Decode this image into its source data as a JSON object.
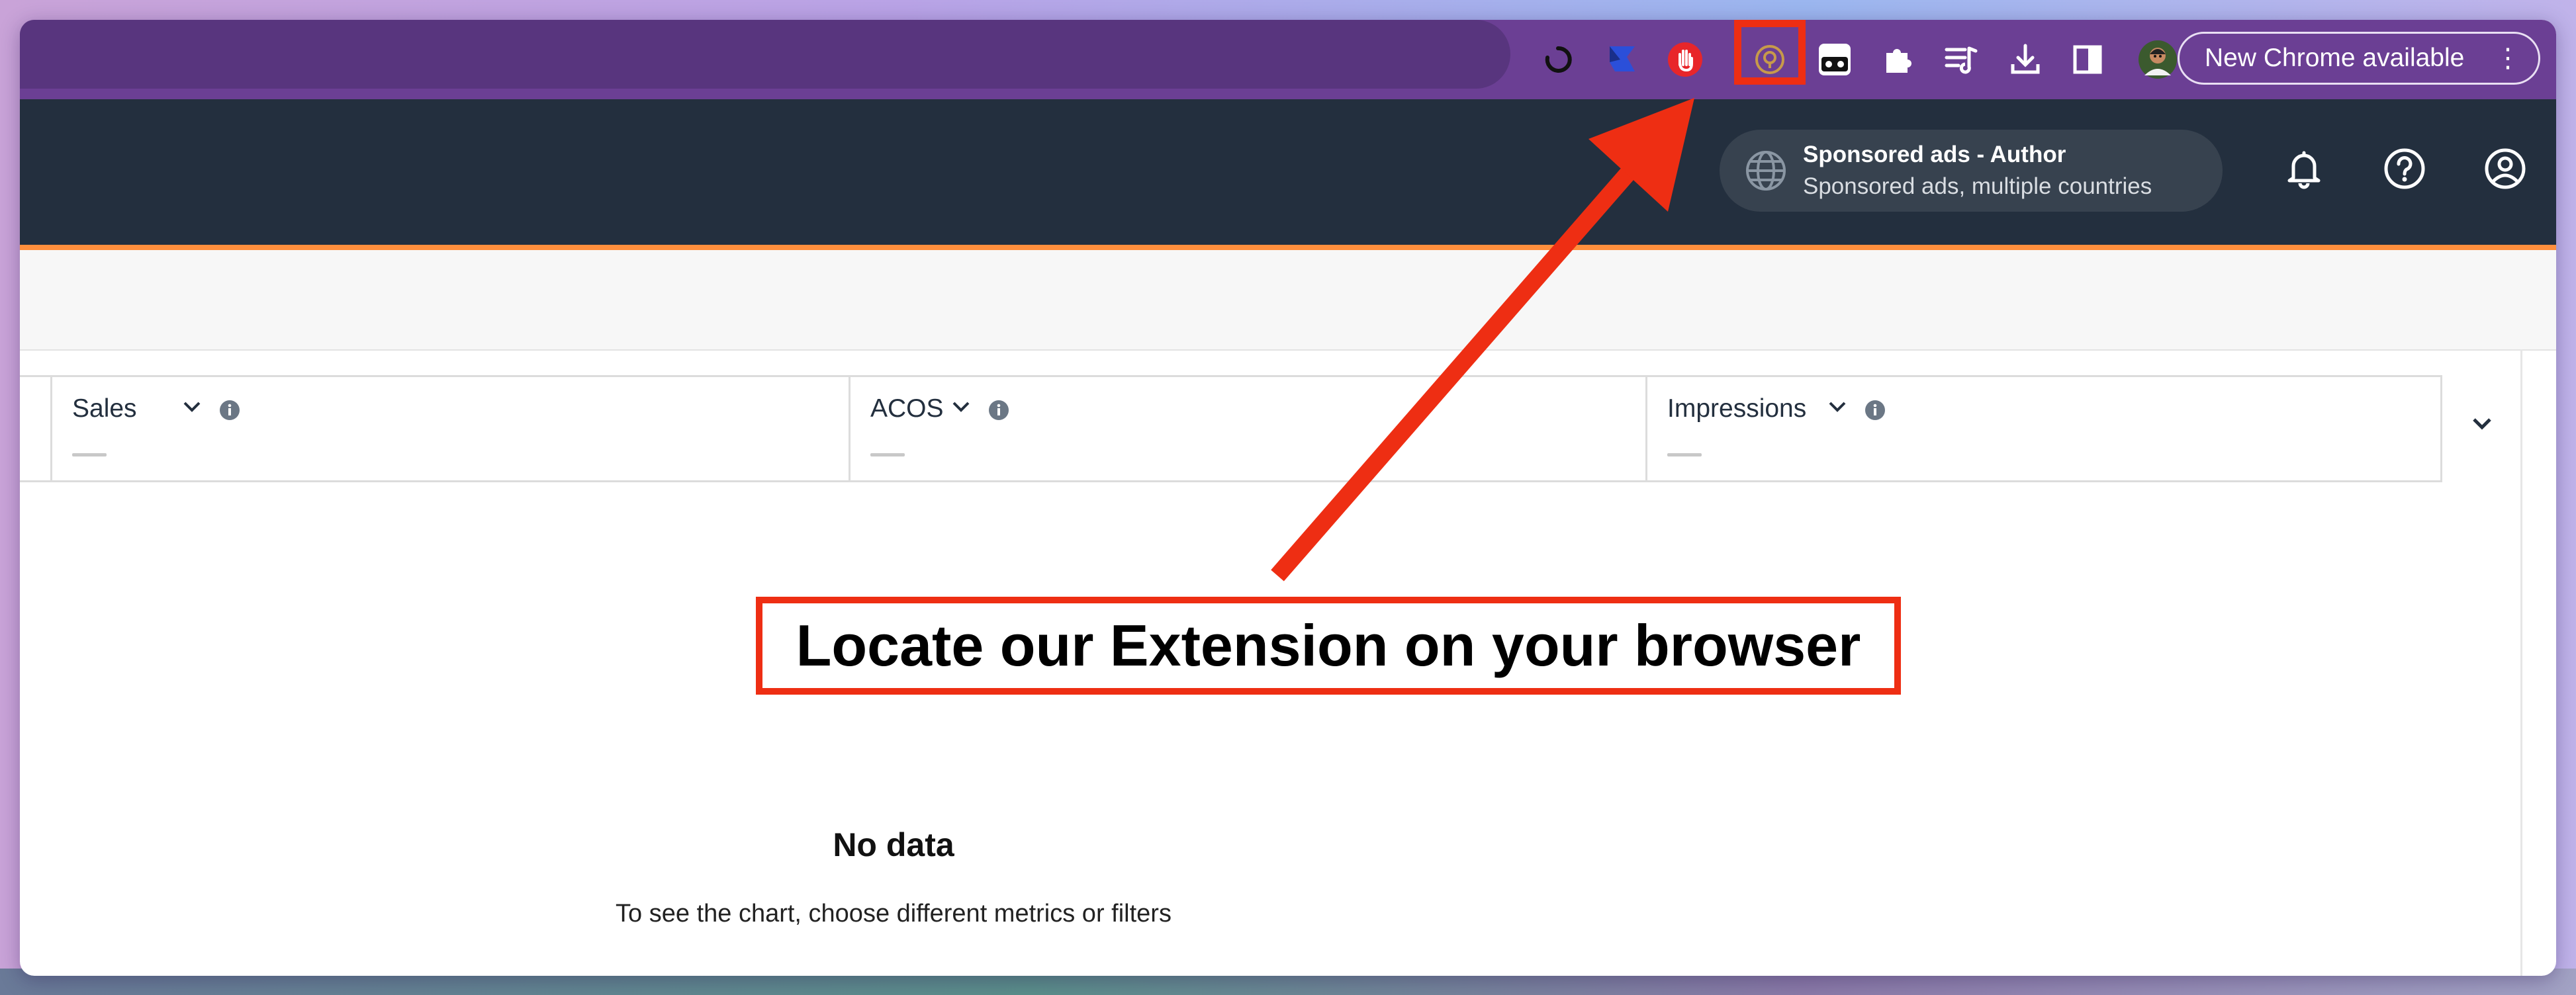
{
  "browser": {
    "extensions": [
      {
        "name": "sync-icon"
      },
      {
        "name": "flag-extension-icon"
      },
      {
        "name": "hand-stop-extension-icon"
      },
      {
        "name": "target-extension-icon"
      },
      {
        "name": "glasses-extension-icon"
      },
      {
        "name": "puzzle-piece-icon"
      },
      {
        "name": "reading-list-icon"
      },
      {
        "name": "download-icon"
      },
      {
        "name": "side-panel-icon"
      },
      {
        "name": "profile-avatar-icon"
      }
    ],
    "update_button_label": "New Chrome available",
    "menu_icon": "kebab-menu-icon",
    "colors": {
      "toolbar": "#6b3f94",
      "omnibox": "#58357e"
    }
  },
  "app_header": {
    "account": {
      "title": "Sponsored ads - Author",
      "subtitle": "Sponsored ads, multiple countries"
    },
    "icons": [
      "bell-icon",
      "help-icon",
      "account-icon"
    ],
    "colors": {
      "background": "#232f3e",
      "accent": "#ff8f3d"
    }
  },
  "metrics": [
    {
      "label": "Sales",
      "value": "—"
    },
    {
      "label": "ACOS",
      "value": "—"
    },
    {
      "label": "Impressions",
      "value": "—"
    }
  ],
  "empty_state": {
    "title": "No data",
    "message": "To see the chart, choose different metrics or filters"
  },
  "annotation": {
    "text": "Locate our Extension on your browser",
    "color": "#ee2e13"
  }
}
